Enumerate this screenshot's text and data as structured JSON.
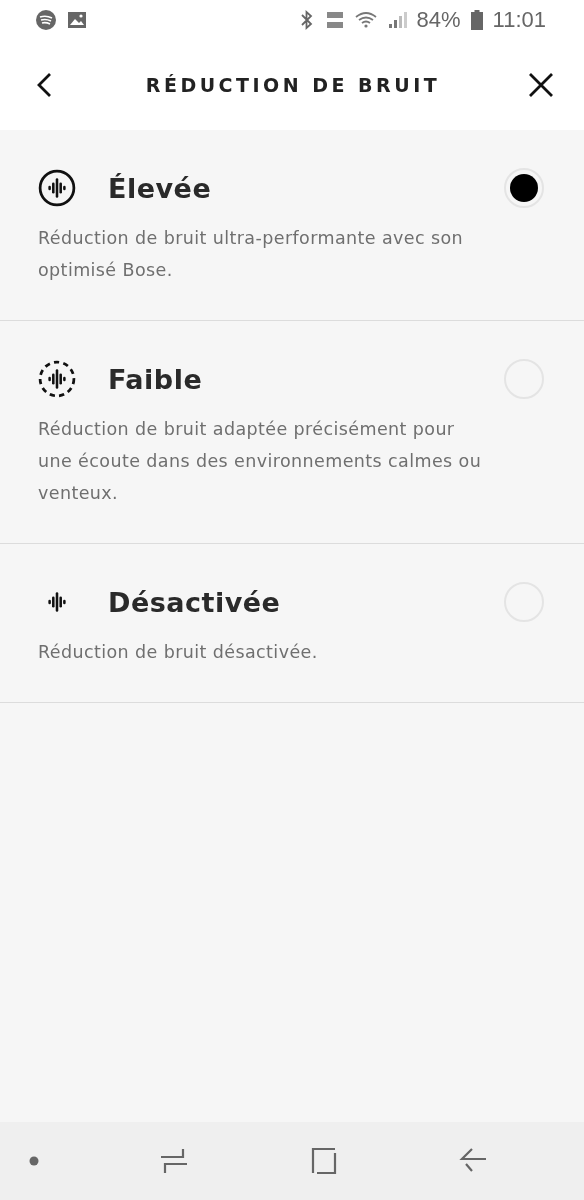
{
  "status_bar": {
    "battery": "84%",
    "time": "11:01"
  },
  "header": {
    "title": "RÉDUCTION DE BRUIT"
  },
  "options": [
    {
      "kind": "solid",
      "title": "Élevée",
      "description": "Réduction de bruit ultra-performante avec son optimisé Bose.",
      "selected": true
    },
    {
      "kind": "dashed",
      "title": "Faible",
      "description": "Réduction de bruit adaptée précisément pour une écoute dans des environnements calmes ou venteux.",
      "selected": false
    },
    {
      "kind": "bare",
      "title": "Désactivée",
      "description": "Réduction de bruit désactivée.",
      "selected": false
    }
  ]
}
